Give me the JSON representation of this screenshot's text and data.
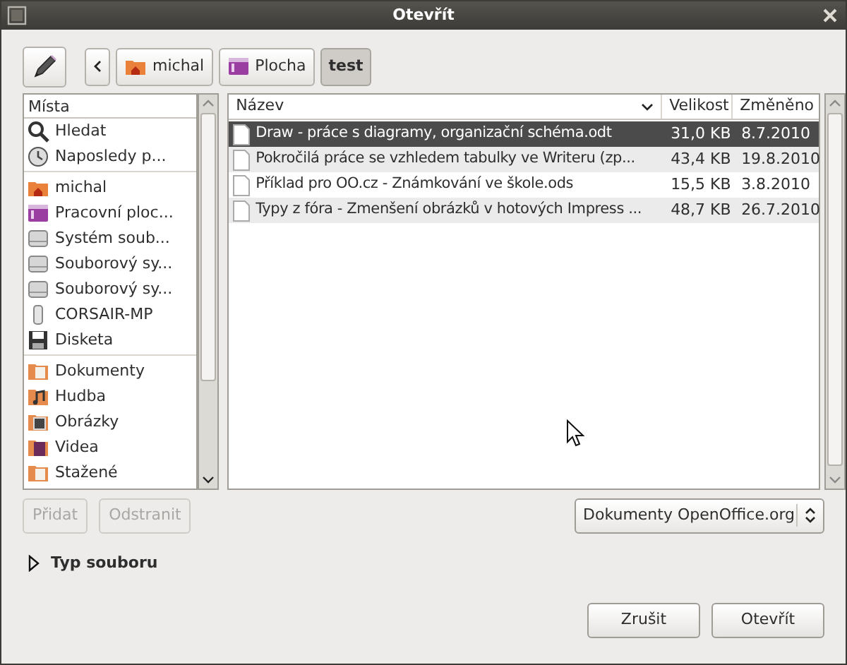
{
  "window": {
    "title": "Otevřít"
  },
  "path": [
    {
      "label": "michal",
      "kind": "home",
      "selected": false
    },
    {
      "label": "Plocha",
      "kind": "desktop",
      "selected": false
    },
    {
      "label": "test",
      "kind": "plain",
      "selected": true
    }
  ],
  "places": {
    "heading": "Místa",
    "groups": [
      [
        {
          "label": "Hledat",
          "kind": "search"
        },
        {
          "label": "Naposledy p...",
          "kind": "recent"
        }
      ],
      [
        {
          "label": "michal",
          "kind": "home"
        },
        {
          "label": "Pracovní ploc...",
          "kind": "desktop"
        },
        {
          "label": "Systém soub...",
          "kind": "drive"
        },
        {
          "label": "Souborový sy...",
          "kind": "drive"
        },
        {
          "label": "Souborový sy...",
          "kind": "drive"
        },
        {
          "label": "CORSAIR-MP",
          "kind": "usb"
        },
        {
          "label": "Disketa",
          "kind": "floppy"
        }
      ],
      [
        {
          "label": "Dokumenty",
          "kind": "folder"
        },
        {
          "label": "Hudba",
          "kind": "music"
        },
        {
          "label": "Obrázky",
          "kind": "pictures"
        },
        {
          "label": "Videa",
          "kind": "videos"
        },
        {
          "label": "Stažené",
          "kind": "folder"
        }
      ]
    ]
  },
  "place_buttons": [
    {
      "label": "Přidat",
      "disabled": true
    },
    {
      "label": "Odstranit",
      "disabled": true
    }
  ],
  "files": {
    "columns": [
      "Název",
      "Velikost",
      "Změněno"
    ],
    "rows": [
      {
        "name": "Draw - práce s diagramy, organizační schéma.odt",
        "size": "31,0 KB",
        "modified": "8.7.2010",
        "selected": true
      },
      {
        "name": "Pokročilá práce se vzhledem tabulky ve Writeru (zp...",
        "size": "43,4 KB",
        "modified": "19.8.2010",
        "selected": false
      },
      {
        "name": "Příklad pro OO.cz - Známkování ve škole.ods",
        "size": "15,5 KB",
        "modified": "3.8.2010",
        "selected": false
      },
      {
        "name": "Typy z fóra - Zmenšení obrázků v hotových Impress ...",
        "size": "48,7 KB",
        "modified": "26.7.2010",
        "selected": false
      }
    ]
  },
  "filter": {
    "value": "Dokumenty OpenOffice.org"
  },
  "expander": {
    "label": "Typ souboru",
    "expanded": false
  },
  "buttons": [
    {
      "label": "Zrušit"
    },
    {
      "label": "Otevřít"
    }
  ]
}
